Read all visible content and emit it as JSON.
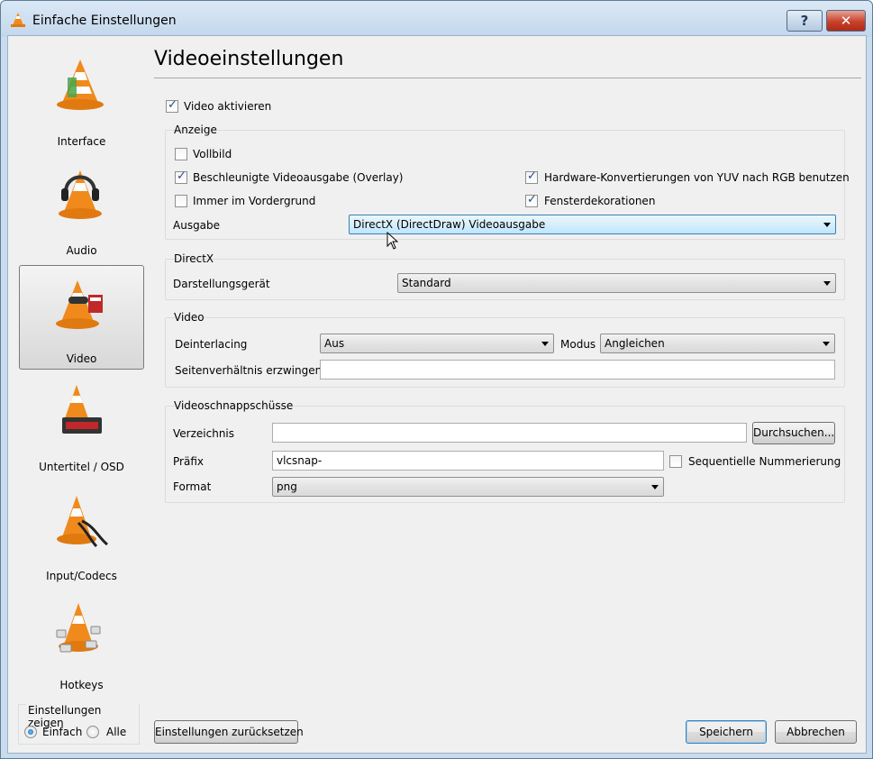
{
  "window": {
    "title": "Einfache Einstellungen",
    "help_label": "?",
    "close_label": "✕"
  },
  "sidebar": {
    "items": [
      {
        "label": "Interface",
        "icon": "vlc-cone-icon",
        "selected": false
      },
      {
        "label": "Audio",
        "icon": "vlc-cone-headphones-icon",
        "selected": false
      },
      {
        "label": "Video",
        "icon": "vlc-cone-video-icon",
        "selected": true
      },
      {
        "label": "Untertitel / OSD",
        "icon": "vlc-cone-subtitles-icon",
        "selected": false
      },
      {
        "label": "Input/Codecs",
        "icon": "vlc-cone-cables-icon",
        "selected": false
      },
      {
        "label": "Hotkeys",
        "icon": "vlc-cone-keys-icon",
        "selected": false
      }
    ],
    "show_settings": {
      "title": "Einstellungen zeigen",
      "simple": "Einfach",
      "all": "Alle",
      "selected": "Einfach"
    }
  },
  "main": {
    "title": "Videoeinstellungen",
    "enable_video": {
      "label": "Video aktivieren",
      "checked": true
    },
    "display": {
      "title": "Anzeige",
      "fullscreen": {
        "label": "Vollbild",
        "checked": false
      },
      "overlay": {
        "label": "Beschleunigte Videoausgabe (Overlay)",
        "checked": true
      },
      "hw_yuv": {
        "label": "Hardware-Konvertierungen von YUV nach RGB benutzen",
        "checked": true
      },
      "on_top": {
        "label": "Immer im Vordergrund",
        "checked": false
      },
      "decorations": {
        "label": "Fensterdekorationen",
        "checked": true
      },
      "output_label": "Ausgabe",
      "output_value": "DirectX (DirectDraw) Videoausgabe"
    },
    "directx": {
      "title": "DirectX",
      "device_label": "Darstellungsgerät",
      "device_value": "Standard"
    },
    "video": {
      "title": "Video",
      "deinterlace_label": "Deinterlacing",
      "deinterlace_value": "Aus",
      "mode_label": "Modus",
      "mode_value": "Angleichen",
      "aspect_label": "Seitenverhältnis erzwingen",
      "aspect_value": ""
    },
    "snapshots": {
      "title": "Videoschnappschüsse",
      "dir_label": "Verzeichnis",
      "dir_value": "",
      "browse_label": "Durchsuchen...",
      "prefix_label": "Präfix",
      "prefix_value": "vlcsnap-",
      "sequential": {
        "label": "Sequentielle Nummerierung",
        "checked": false
      },
      "format_label": "Format",
      "format_value": "png"
    }
  },
  "footer": {
    "reset_label": "Einstellungen zurücksetzen",
    "save_label": "Speichern",
    "cancel_label": "Abbrechen"
  },
  "colors": {
    "cone_orange": "#f08a1c",
    "cone_stripe": "#ffffff",
    "accent_blue": "#3c7fb1"
  }
}
